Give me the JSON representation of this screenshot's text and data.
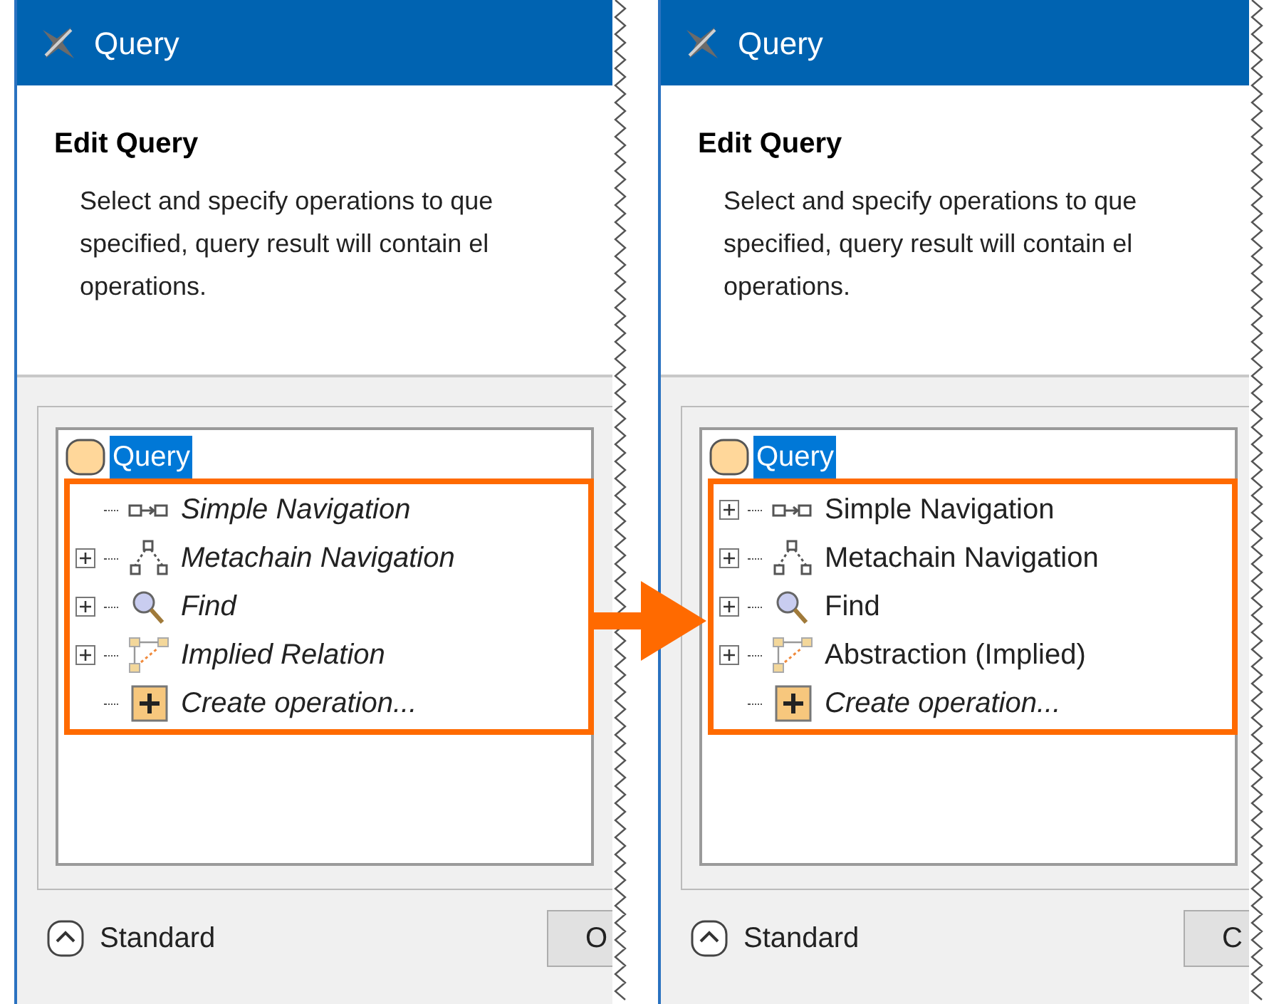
{
  "panels": [
    {
      "window": {
        "title": "Query"
      },
      "heading": "Edit Query",
      "description": [
        "Select and specify operations to que",
        "specified, query result will contain el",
        "operations."
      ],
      "tree": {
        "root": {
          "label": "Query",
          "selected": true
        },
        "items": [
          {
            "kind": "simple",
            "label": "Simple Navigation",
            "italic": true,
            "expandable": false
          },
          {
            "kind": "metachain",
            "label": "Metachain Navigation",
            "italic": true,
            "expandable": true
          },
          {
            "kind": "find",
            "label": "Find",
            "italic": true,
            "expandable": true
          },
          {
            "kind": "implied",
            "label": "Implied Relation",
            "italic": true,
            "expandable": true
          },
          {
            "kind": "create",
            "label": "Create operation...",
            "italic": true,
            "expandable": false
          }
        ]
      },
      "mode": {
        "label": "Standard"
      },
      "button": {
        "label": "O"
      }
    },
    {
      "window": {
        "title": "Query"
      },
      "heading": "Edit Query",
      "description": [
        "Select and specify operations to que",
        "specified, query result will contain el",
        "operations."
      ],
      "tree": {
        "root": {
          "label": "Query",
          "selected": true
        },
        "items": [
          {
            "kind": "simple",
            "label": "Simple Navigation",
            "italic": false,
            "expandable": true
          },
          {
            "kind": "metachain",
            "label": "Metachain Navigation",
            "italic": false,
            "expandable": true
          },
          {
            "kind": "find",
            "label": "Find",
            "italic": false,
            "expandable": true
          },
          {
            "kind": "implied",
            "label": "Abstraction (Implied)",
            "italic": false,
            "expandable": true
          },
          {
            "kind": "create",
            "label": "Create operation...",
            "italic": true,
            "expandable": false
          }
        ]
      },
      "mode": {
        "label": "Standard"
      },
      "button": {
        "label": "C"
      }
    }
  ]
}
